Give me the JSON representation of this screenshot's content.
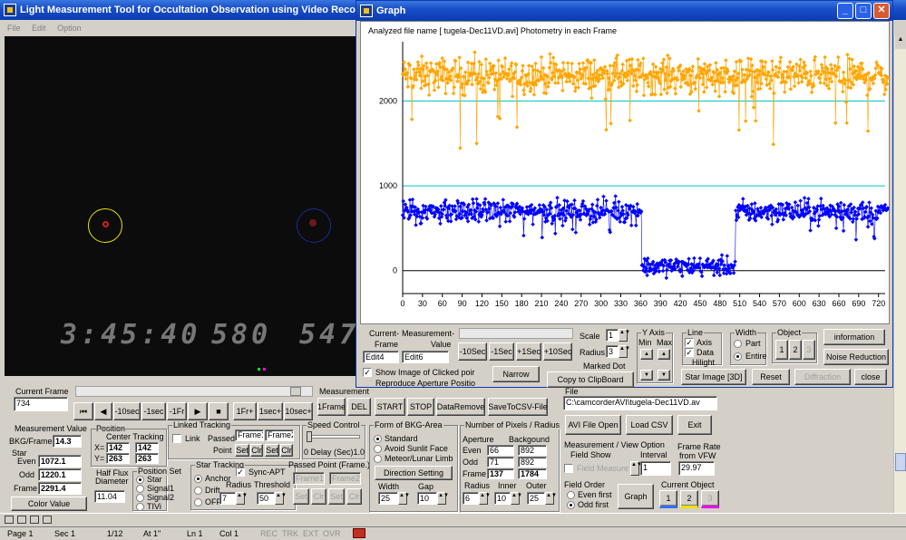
{
  "main_title": "Light Measurement Tool for Occultation Observation using Video Recorder [L",
  "menu": [
    "File",
    "Edit",
    "Option"
  ],
  "video": {
    "timestamp": "3:45:40",
    "field1": "580",
    "field2": "547"
  },
  "current_frame": {
    "label": "Current Frame",
    "value": "734"
  },
  "playback": [
    "⏮",
    "◀",
    "-10sec",
    "-1sec",
    "-1Fr",
    "▶",
    "■",
    "1Fr+",
    "1sec+",
    "10sec+"
  ],
  "measurement": {
    "label": "Measurement",
    "buttons": [
      "1Frame",
      "DEL",
      "START",
      "STOP",
      "DataRemove",
      "SaveToCSV-File"
    ]
  },
  "mvalue": {
    "label": "Measurement Value",
    "bkg_label": "BKG/Frame",
    "bkg": "14.3",
    "star_label": "Star",
    "even_label": "Even",
    "even": "1072.1",
    "odd_label": "Odd",
    "odd": "1220.1",
    "frame_label": "Frame",
    "frame": "2291.4",
    "color_btn": "Color Value"
  },
  "position": {
    "label": "Position",
    "center": "Center Tracking",
    "x_label": "X=",
    "x1": "142",
    "x2": "142",
    "y_label": "Y=",
    "y1": "263",
    "y2": "263"
  },
  "halfflux": {
    "label1": "Half Flux",
    "label2": "Diameter",
    "value": "11.04"
  },
  "posset": {
    "label": "Position Set",
    "options": [
      "Star",
      "Signal1",
      "Signal2",
      "TIVi"
    ]
  },
  "linked": {
    "label": "Linked Tracking",
    "link": "Link",
    "passed": "Passed-",
    "point": "Point",
    "frame1": "Frame1",
    "frame2": "Frame2",
    "set": "Set",
    "clr": "Clr"
  },
  "startrack": {
    "label": "Star Tracking",
    "options": [
      "Anchor",
      "Drift",
      "OFF"
    ],
    "syncapt": "Sync-APT",
    "radius": "Radius",
    "threshold": "Threshold",
    "radius_v": "7",
    "threshold_v": "50"
  },
  "passedpt": {
    "label": "Passed Point (Frame.)",
    "f1": "Frame1",
    "f2": "Frame2",
    "btns": [
      "Set",
      "Clr",
      "Set",
      "Clr"
    ]
  },
  "speed": {
    "label": "Speed Control",
    "text": "0  Delay (Sec)1.0"
  },
  "bkg": {
    "label": "Form of BKG-Area",
    "options": [
      "Standard",
      "Avoid Sunlit Face",
      "Meteor/Lunar Limb"
    ],
    "dir_btn": "Direction Setting",
    "width": "Width",
    "gap": "Gap",
    "width_v": "25",
    "gap_v": "10"
  },
  "pixels": {
    "label": "Number of Pixels / Radius",
    "aperture": "Aperture",
    "background": "Backgound",
    "even": "Even",
    "odd": "Odd",
    "frame": "Frame",
    "even_a": "66",
    "even_b": "892",
    "odd_a": "71",
    "odd_b": "892",
    "frame_a": "137",
    "frame_b": "1784",
    "radius": "Radius",
    "inner": "Inner",
    "outer": "Outer",
    "radius_v": "6",
    "inner_v": "10",
    "outer_v": "25"
  },
  "file": {
    "label": "File",
    "path": "C:\\camcorderAVI\\tugela-Dec11VD.av",
    "open": "AVI File Open",
    "loadcsv": "Load CSV",
    "exit": "Exit"
  },
  "mview": {
    "label": "Measurement / View Option",
    "field_show": "Field Show",
    "field_measure": "Field Measure",
    "interval": "Interval",
    "interval_v": "1",
    "framerate": "Frame Rate",
    "fromvfw": "from VFW",
    "rate_v": "29.97"
  },
  "fieldorder": {
    "label": "Field Order",
    "even": "Even first",
    "odd": "Odd first",
    "graph_btn": "Graph"
  },
  "curobj": {
    "label": "Current Object",
    "items": [
      "1",
      "2",
      "3"
    ]
  },
  "status": {
    "page": "Page  1",
    "sec": "Sec  1",
    "pages": "1/12",
    "at": "At  1\"",
    "ln": "Ln  1",
    "col": "Col  1",
    "rec": "REC",
    "trk": "TRK",
    "ext": "EXT",
    "ovr": "OVR"
  },
  "graph": {
    "title": "Graph",
    "file_line": "Analyzed file name [ tugela-Dec11VD.avi]   Photometry in each Frame",
    "current_frame": "Current-\nFrame",
    "mv": "Measurement-\nValue",
    "edit4": "Edit4",
    "edit6": "Edit6",
    "nav": [
      "-10Sec",
      "-1Sec",
      "+1Sec",
      "+10Sec"
    ],
    "show_image": "Show Image of Clicked poir",
    "reproduce": "Reproduce Aperture Positio",
    "narrow": "Narrow",
    "clipboard": "Copy to ClipBoard",
    "scale": "Scale",
    "scale_v": "1",
    "radius": "Radius",
    "radius_v": "3",
    "marked": "Marked Dot",
    "yaxis": "Y Axis",
    "min": "Min",
    "max": "Max",
    "line": "Line",
    "axis": "Axis",
    "data": "Data",
    "hilight": "Hilight",
    "width": "Width",
    "part": "Part",
    "entire": "Entire",
    "object": "Object",
    "obj_items": [
      "1",
      "2",
      "3"
    ],
    "info": "information",
    "noise": "Noise Reduction",
    "star3d": "Star Image [3D]",
    "reset": "Reset",
    "diffraction": "Diffraction",
    "close": "close"
  },
  "chart_data": {
    "type": "scatter",
    "xlim": [
      0,
      730
    ],
    "ylim": [
      -270,
      2700
    ],
    "xticks": [
      0,
      30,
      60,
      90,
      120,
      150,
      180,
      210,
      240,
      270,
      300,
      330,
      360,
      390,
      420,
      450,
      480,
      510,
      540,
      570,
      600,
      630,
      660,
      690,
      720
    ],
    "yticks": [
      0,
      1000,
      2000
    ],
    "series": [
      {
        "color": "#ffa500",
        "baseline": 2300,
        "jitter": 170,
        "dips": [],
        "note_color": "orange"
      },
      {
        "color": "#0000ff",
        "baseline": 700,
        "jitter": 110,
        "event": {
          "start": 362,
          "end": 503,
          "level": 50
        },
        "note_color": "blue"
      }
    ],
    "hlines": [
      {
        "y": 2000,
        "color": "#00c8c8"
      },
      {
        "y": 1000,
        "color": "#00c8c8"
      },
      {
        "y": 0,
        "color": "#000000"
      }
    ]
  }
}
